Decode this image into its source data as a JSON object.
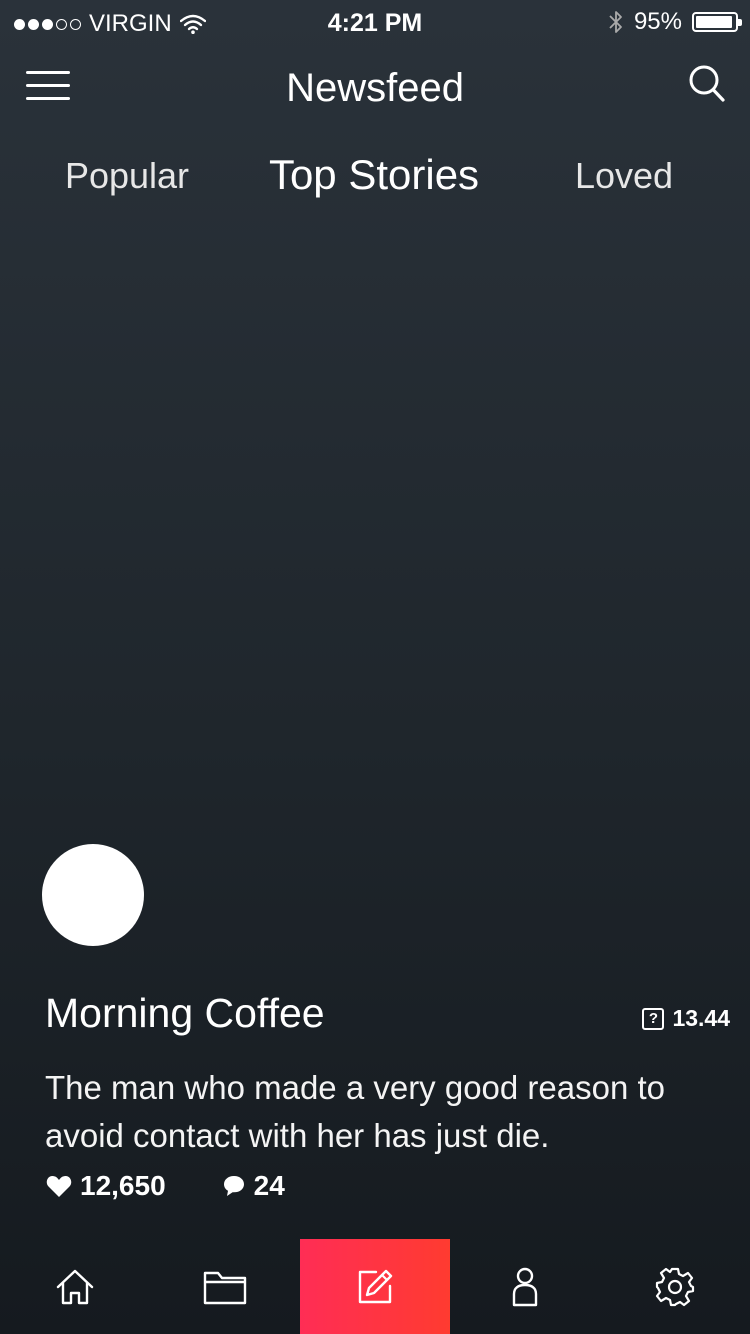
{
  "status_bar": {
    "carrier": "VIRGIN",
    "time": "4:21 PM",
    "battery_percent": "95%",
    "battery_level": 0.95,
    "signal_bars_filled": 3,
    "signal_bars_total": 5,
    "icons": [
      "wifi-icon",
      "bluetooth-icon",
      "battery-icon"
    ]
  },
  "header": {
    "title": "Newsfeed",
    "menu_icon": "hamburger-menu-icon",
    "search_icon": "search-icon"
  },
  "tabs": [
    {
      "label": "Popular",
      "active": false
    },
    {
      "label": "Top Stories",
      "active": true
    },
    {
      "label": "Loved",
      "active": false
    }
  ],
  "story": {
    "title": "Morning Coffee",
    "time": "13.44",
    "text": "The man who made a very good reason to avoid contact with her has just die.",
    "likes": "12,650",
    "comments": "24"
  },
  "tabbar": {
    "items": [
      "home-icon",
      "folder-icon",
      "compose-icon",
      "profile-icon",
      "settings-icon"
    ],
    "active_index": 2,
    "active_color": "#ff2d55"
  },
  "colors": {
    "background_top": "#2a323a",
    "background_bottom": "#151a1f",
    "accent": "#ff3b30",
    "text": "#ffffff"
  }
}
